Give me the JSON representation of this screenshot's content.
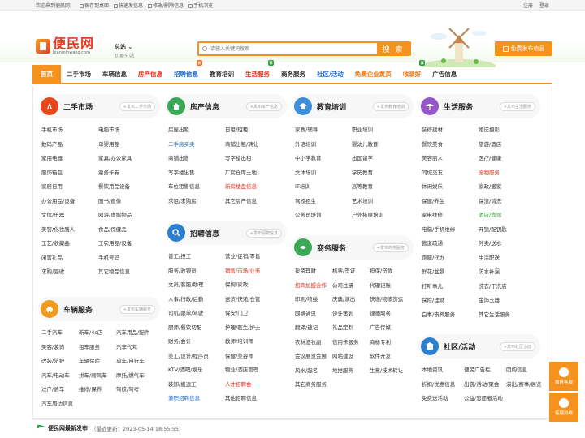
{
  "topbar": {
    "welcome": "欢迎来到便民网！",
    "links": [
      "保存到桌面",
      "快速发信息",
      "修改/删除信息",
      "手机浏览"
    ],
    "right": [
      "注册",
      "登录"
    ]
  },
  "logo": {
    "cn": "便民网",
    "en": "bianminwang.com"
  },
  "city": {
    "name": "总站",
    "switch": "切换分站"
  },
  "search": {
    "placeholder": "请输入关键词搜索",
    "button": "搜 索"
  },
  "post_button": "免费发布信息",
  "nav": [
    {
      "label": "首页",
      "style": "active",
      "badge": ""
    },
    {
      "label": "二手市场",
      "style": "",
      "badge": ""
    },
    {
      "label": "车辆信息",
      "style": "",
      "badge": ""
    },
    {
      "label": "房产信息",
      "style": "red",
      "badge": ""
    },
    {
      "label": "招聘信息",
      "style": "blue",
      "badge": "热"
    },
    {
      "label": "教育培训",
      "style": "",
      "badge": ""
    },
    {
      "label": "生活服务",
      "style": "red",
      "badge": "荐"
    },
    {
      "label": "商务服务",
      "style": "",
      "badge": ""
    },
    {
      "label": "社区/活动",
      "style": "blue",
      "badge": ""
    },
    {
      "label": "免费企业黄页",
      "style": "orange",
      "badge": ""
    },
    {
      "label": "收录好",
      "style": "orange",
      "badge": "荐"
    },
    {
      "label": "广告信息",
      "style": "",
      "badge": ""
    }
  ],
  "blocks": {
    "ershou": {
      "title": "二手市场",
      "post": "+发布二手市场",
      "links": [
        "手机市场",
        "电脑市场",
        "数码产品",
        "母婴用品",
        "家用电器",
        "家具/办公家具",
        "服饰箱包",
        "票务卡券",
        "家居日用",
        "餐饮用品设备",
        "办公用品/设备",
        "图书/音像",
        "文体/乐器",
        "网游/虚拟物品",
        "美容/化妆膳人",
        "食品/保健品",
        "工艺/收藏品",
        "工农用品/设备",
        "闲置礼品",
        "手机号码",
        "求购/回收",
        "其它物品信息"
      ]
    },
    "cheliang": {
      "title": "车辆服务",
      "post": "+发布车辆服务",
      "links": [
        "二手汽车",
        "新车/4s店",
        "美容/装饰",
        "租车服务",
        "改装/防护",
        "车辆保险",
        "汽车/电动车",
        "拼车/顺风车",
        "过户/验车",
        "维修/保养",
        "汽车周边信息",
        ""
      ],
      "links2": [
        "汽车用品/配件",
        "汽车代驾",
        "单车/自行车",
        "摩托/燃气车",
        "驾校/驾考"
      ]
    },
    "fangchan": {
      "title": "房产信息",
      "post": "+发布房产信息",
      "links": [
        "房屋出租",
        "日租/短租",
        "二手房买卖",
        "商铺出租/转让",
        "商铺出售",
        "写字楼出租",
        "写字楼出售",
        "厂房仓库土地",
        "车位租售信息",
        "新房楼盘信息",
        "求租/求购房",
        "其它房产信息"
      ]
    },
    "zhaopin": {
      "title": "招聘信息",
      "post": "+发布招聘信息",
      "links": [
        "普工/技工",
        "营业/促销/零售",
        "服务/收银员",
        "销售/市场/业务",
        "文员/客服/助理",
        "保姆/家政",
        "人事/行政/后勤",
        "送货/快递/仓管",
        "司机/跟单/驾驶",
        "保安/门卫",
        "厨师/餐饮切配",
        "护理/医生/护士",
        "财务/会计",
        "教师/培训师",
        "美工/设计/程序员",
        "保健/美容师",
        "KTV/酒吧/娱乐",
        "物业/酒店管理",
        "装卸/搬运工",
        "人才招聘会",
        "兼职招聘信息",
        "其他招聘信息"
      ]
    },
    "jiaoyu": {
      "title": "教育培训",
      "post": "+发布教育培训",
      "links": [
        "家教/辅导",
        "职业培训",
        "外语培训",
        "婴幼儿教育",
        "中小学教育",
        "出国留学",
        "文体培训",
        "学历教育",
        "IT培训",
        "高等教育",
        "驾校招生",
        "艺术培训",
        "公务员培训",
        "户外拓展培训"
      ]
    },
    "shangwu": {
      "title": "商务服务",
      "post": "+发布商务服务",
      "links": [
        "投资理财",
        "机票/签证",
        "担保/贷款",
        "招商加盟合作",
        "公司注册",
        "代理记账",
        "印刷/喷绘",
        "庆典/演出",
        "快递/物流货运",
        "网络通讯",
        "设计策划",
        "律师服务",
        "翻译/速记",
        "礼品定制",
        "广告传媒",
        "农林渔牧副",
        "信用卡服务",
        "商标专利",
        "会议展览会展",
        "网站建设",
        "软件开发",
        "风水/起名",
        "地推服务",
        "生意/技术转让",
        "其它商务服务",
        "",
        ""
      ]
    },
    "shenghuo": {
      "title": "生活服务",
      "post": "+发布生活服务",
      "links": [
        "装修建材",
        "婚庆摄影",
        "餐饮美食",
        "旅游/酒店",
        "美容丽人",
        "医疗/健康",
        "同城交友",
        "宠物服务",
        "休闲娱乐",
        "家政/搬家",
        "保健/养生",
        "保洁/清洗",
        "家电维修",
        "酒店/宾馆",
        "电脑/手机维修",
        "开锁/配钥匙",
        "管道疏通",
        "外卖/送水",
        "跑腿/代办",
        "生活配送",
        "鲜花/盆景",
        "防水补漏",
        "打听事儿",
        "洗衣/干洗店",
        "保险/理财",
        "金饰玉器",
        "白事/丧葬服务",
        "其它生活服务"
      ]
    },
    "shequ": {
      "title": "社区/活动",
      "post": "+发布社区活动",
      "links": [
        "本地资讯",
        "便民广告栏",
        "团购信息",
        "折扣/优惠信息",
        "出游/活动/聚会",
        "演出/赛事/展览",
        "免费送活动",
        "公益/志愿者活动",
        ""
      ]
    }
  },
  "news": {
    "title": "便民网最新发布",
    "updated": "（最近更新：2023-05-14 18:55:55）"
  },
  "side": [
    "微信客服",
    "客服热线"
  ]
}
